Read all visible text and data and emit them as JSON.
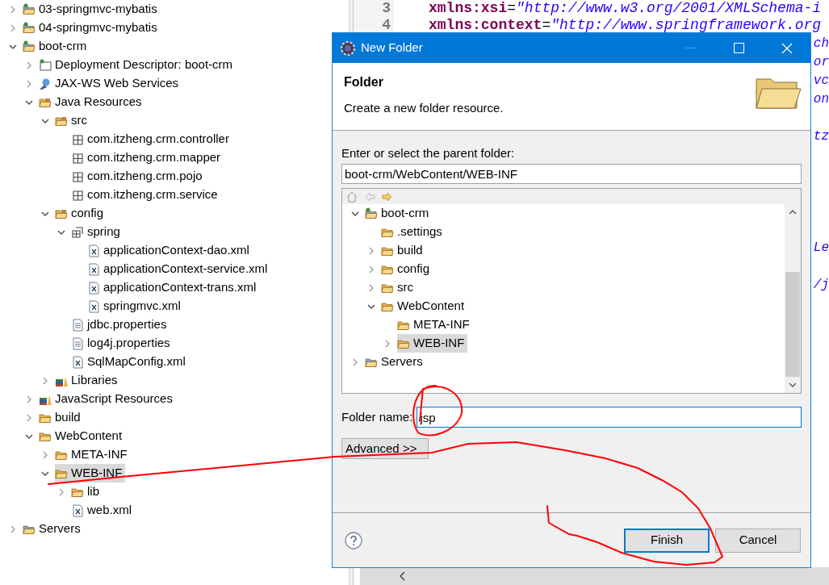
{
  "explorer": {
    "items": [
      {
        "label": "03-springmvc-mybatis",
        "kind": "project",
        "expanded": false,
        "selected": false
      },
      {
        "label": "04-springmvc-mybatis",
        "kind": "project",
        "expanded": false,
        "selected": false
      },
      {
        "label": "boot-crm",
        "kind": "project",
        "expanded": true,
        "selected": false,
        "children": [
          {
            "label": "Deployment Descriptor: boot-crm",
            "kind": "descriptor",
            "expanded": false,
            "selected": false
          },
          {
            "label": "JAX-WS Web Services",
            "kind": "webservices",
            "expanded": false,
            "selected": false
          },
          {
            "label": "Java Resources",
            "kind": "resources",
            "expanded": true,
            "selected": false,
            "children": [
              {
                "label": "src",
                "kind": "sourcefolder",
                "expanded": true,
                "selected": false,
                "children": [
                  {
                    "label": "com.itzheng.crm.controller",
                    "kind": "package",
                    "selected": false
                  },
                  {
                    "label": "com.itzheng.crm.mapper",
                    "kind": "package",
                    "selected": false
                  },
                  {
                    "label": "com.itzheng.crm.pojo",
                    "kind": "package",
                    "selected": false
                  },
                  {
                    "label": "com.itzheng.crm.service",
                    "kind": "package",
                    "selected": false
                  }
                ]
              },
              {
                "label": "config",
                "kind": "sourcefolder",
                "expanded": true,
                "selected": false,
                "children": [
                  {
                    "label": "spring",
                    "kind": "packagegroup",
                    "expanded": true,
                    "selected": false,
                    "children": [
                      {
                        "label": "applicationContext-dao.xml",
                        "kind": "xml",
                        "selected": false
                      },
                      {
                        "label": "applicationContext-service.xml",
                        "kind": "xml",
                        "selected": false
                      },
                      {
                        "label": "applicationContext-trans.xml",
                        "kind": "xml",
                        "selected": false
                      },
                      {
                        "label": "springmvc.xml",
                        "kind": "xml",
                        "selected": false
                      }
                    ]
                  },
                  {
                    "label": "jdbc.properties",
                    "kind": "text",
                    "selected": false
                  },
                  {
                    "label": "log4j.properties",
                    "kind": "text",
                    "selected": false
                  },
                  {
                    "label": "SqlMapConfig.xml",
                    "kind": "xml",
                    "selected": false
                  }
                ]
              },
              {
                "label": "Libraries",
                "kind": "library",
                "expanded": false,
                "selected": false
              }
            ]
          },
          {
            "label": "JavaScript Resources",
            "kind": "library",
            "expanded": false,
            "selected": false
          },
          {
            "label": "build",
            "kind": "folder",
            "expanded": false,
            "selected": false
          },
          {
            "label": "WebContent",
            "kind": "folder",
            "expanded": true,
            "selected": false,
            "children": [
              {
                "label": "META-INF",
                "kind": "folder",
                "expanded": false,
                "selected": false
              },
              {
                "label": "WEB-INF",
                "kind": "folder",
                "expanded": true,
                "selected": true,
                "children": [
                  {
                    "label": "lib",
                    "kind": "folder",
                    "expanded": false,
                    "selected": false
                  },
                  {
                    "label": "web.xml",
                    "kind": "xml",
                    "selected": false
                  }
                ]
              }
            ]
          }
        ]
      },
      {
        "label": "Servers",
        "kind": "servers",
        "expanded": false,
        "selected": false
      }
    ]
  },
  "editor": {
    "lines": [
      {
        "number": "3",
        "parts": [
          {
            "kind": "attr",
            "text": "xmlns:xsi"
          },
          {
            "kind": "punct",
            "text": "="
          },
          {
            "kind": "string",
            "text": "\"http://www.w3.org/2001/XMLSchema-i"
          }
        ]
      },
      {
        "number": "4",
        "parts": [
          {
            "kind": "attr",
            "text": "xmlns:context"
          },
          {
            "kind": "punct",
            "text": "="
          },
          {
            "kind": "string",
            "text": "\"http://www.springframework.org"
          }
        ]
      }
    ],
    "fragments": [
      "ch",
      "or",
      "vc",
      "on",
      "tz",
      "Le",
      "/j"
    ]
  },
  "dialog": {
    "title": "New Folder",
    "heading": "Folder",
    "description": "Create a new folder resource.",
    "parent_label": "Enter or select the parent folder:",
    "parent_value": "boot-crm/WebContent/WEB-INF",
    "tree": [
      {
        "label": "boot-crm",
        "kind": "project",
        "expanded": true,
        "selected": false,
        "children": [
          {
            "label": ".settings",
            "kind": "folder",
            "selected": false
          },
          {
            "label": "build",
            "kind": "folder",
            "expanded": false,
            "selected": false
          },
          {
            "label": "config",
            "kind": "folder",
            "expanded": false,
            "selected": false
          },
          {
            "label": "src",
            "kind": "folder",
            "expanded": false,
            "selected": false
          },
          {
            "label": "WebContent",
            "kind": "folder",
            "expanded": true,
            "selected": false,
            "children": [
              {
                "label": "META-INF",
                "kind": "folder",
                "selected": false
              },
              {
                "label": "WEB-INF",
                "kind": "folder",
                "expanded": false,
                "selected": true
              }
            ]
          }
        ]
      },
      {
        "label": "Servers",
        "kind": "servers",
        "expanded": false,
        "selected": false
      }
    ],
    "name_label": "Folder name:",
    "name_value": "jsp",
    "advanced_button": "Advanced >>",
    "buttons": [
      {
        "label": "Finish",
        "default": true
      },
      {
        "label": "Cancel",
        "default": false
      }
    ]
  }
}
